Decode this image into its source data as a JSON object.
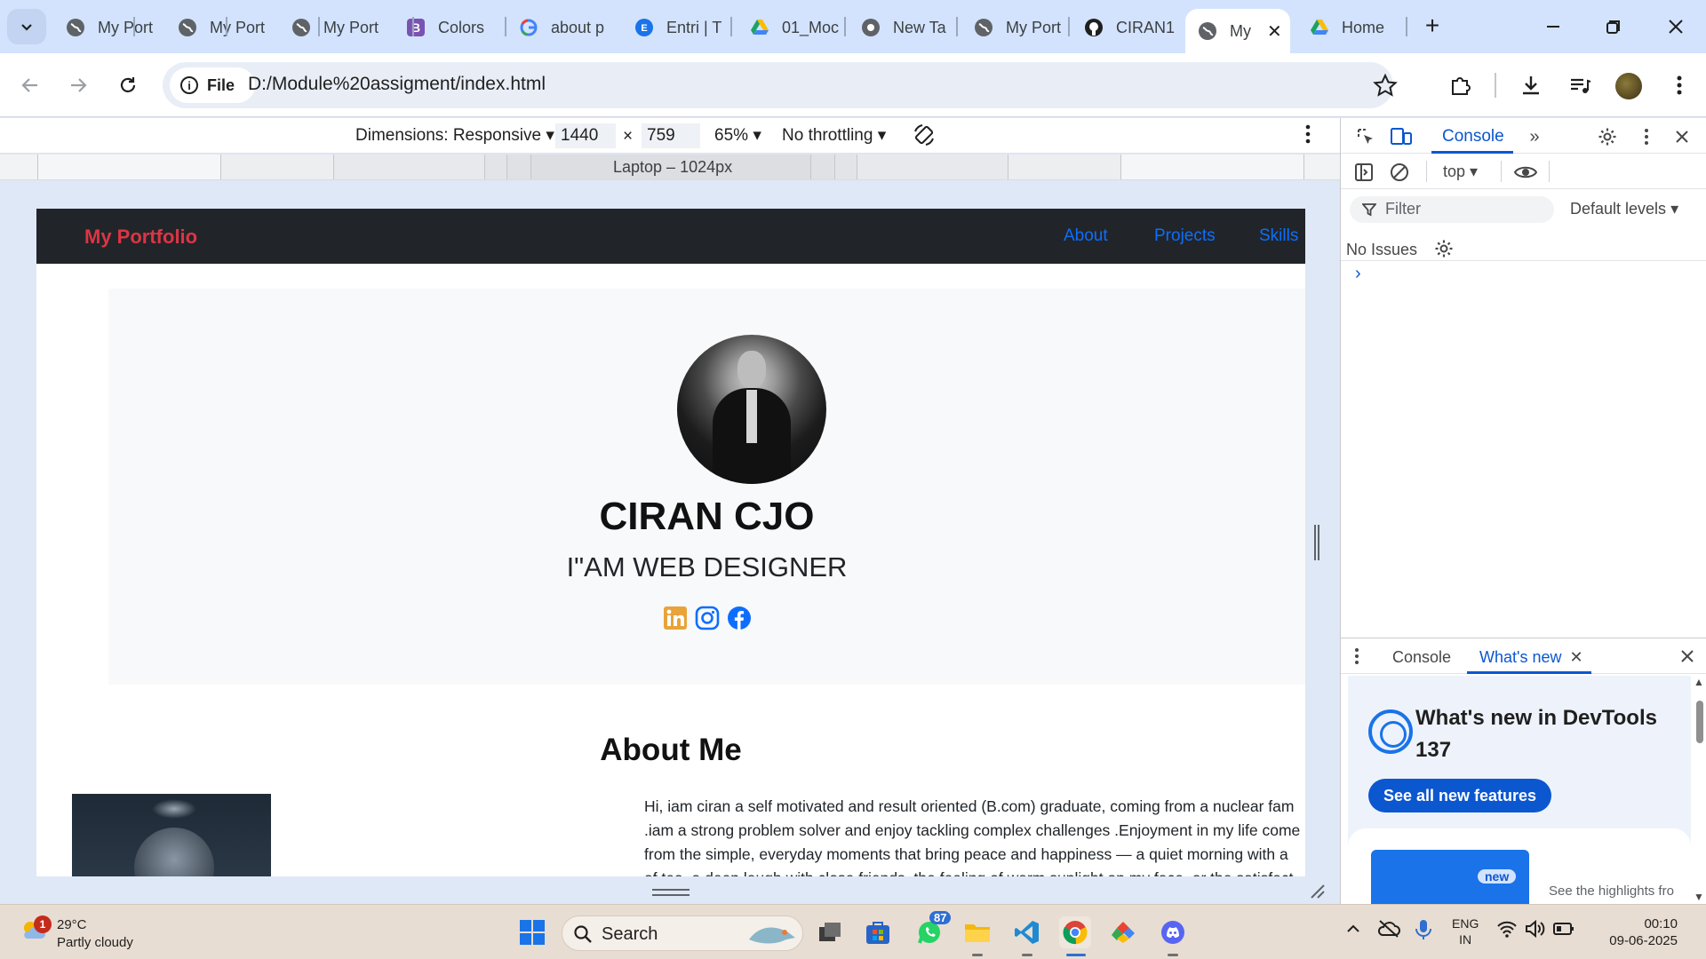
{
  "browser": {
    "tabs": [
      {
        "title": "My Port",
        "icon": "globe-icon"
      },
      {
        "title": "My Port",
        "icon": "globe-icon"
      },
      {
        "title": "My Port",
        "icon": "globe-icon"
      },
      {
        "title": "Colors",
        "icon": "bootstrap-icon"
      },
      {
        "title": "about p",
        "icon": "google-icon"
      },
      {
        "title": "Entri | T",
        "icon": "entri-icon"
      },
      {
        "title": "01_Moc",
        "icon": "google-drive-icon"
      },
      {
        "title": "New Ta",
        "icon": "chrome-icon"
      },
      {
        "title": "My Port",
        "icon": "globe-icon"
      },
      {
        "title": "CIRAN1",
        "icon": "github-icon"
      },
      {
        "title": "My",
        "icon": "globe-icon",
        "active": true
      },
      {
        "title": "Home",
        "icon": "google-drive-icon"
      }
    ],
    "address": {
      "chip_label": "File",
      "url": "D:/Module%20assigment/index.html"
    }
  },
  "device_toolbar": {
    "dimensions_label": "Dimensions: Responsive",
    "width": "1440",
    "times": "×",
    "height": "759",
    "zoom": "65%",
    "throttling": "No throttling",
    "media_label": "Laptop – 1024px"
  },
  "site": {
    "brand": "My Portfolio",
    "nav": [
      "About",
      "Projects",
      "Skills"
    ],
    "hero_name": "CIRAN CJO",
    "hero_subtitle": "I\"AM WEB DESIGNER",
    "about_heading": "About Me",
    "about_lines": [
      "Hi, iam ciran a self motivated and result oriented (B.com) graduate, coming from a nuclear fam",
      ".iam a strong problem solver and enjoy tackling complex challenges .Enjoyment in my life come",
      "from the simple, everyday moments that bring peace and happiness — a quiet morning with a",
      "of tea, a deep laugh with close friends, the feeling of warm sunlight on my face, or the satisfact"
    ],
    "social_icons": [
      "linkedin-icon",
      "instagram-icon",
      "facebook-icon"
    ]
  },
  "devtools": {
    "tab_console": "Console",
    "context": "top",
    "filter_placeholder": "Filter",
    "levels": "Default levels",
    "issues": "No Issues",
    "drawer_tab_console": "Console",
    "drawer_tab_whats_new": "What's new",
    "whats_new_title": "What's new in DevTools 137",
    "whats_new_button": "See all new features",
    "whats_new_badge": "new",
    "whats_new_caption": "See the highlights fro"
  },
  "taskbar": {
    "weather_temp": "29°C",
    "weather_condition": "Partly cloudy",
    "weather_badge": "1",
    "search_label": "Search",
    "whatsapp_badge": "87",
    "lang_line1": "ENG",
    "lang_line2": "IN",
    "time": "00:10",
    "date": "09-06-2025"
  },
  "colors": {
    "brand_red": "#dc3545",
    "link_blue": "#0d6efd",
    "navbar_dark": "#212529",
    "devtools_blue": "#0b57d0"
  }
}
